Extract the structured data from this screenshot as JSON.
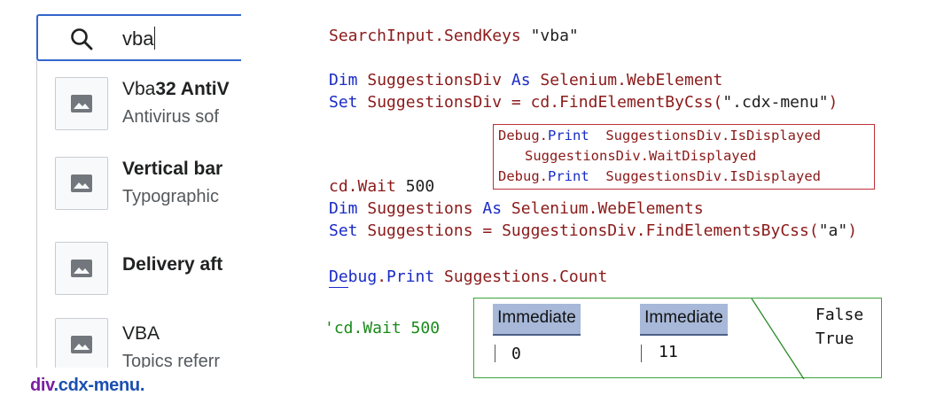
{
  "search": {
    "value": "vba"
  },
  "suggestions": [
    {
      "title_plain": "Vba",
      "title_bold": "32 AntiV",
      "description": "Antivirus sof"
    },
    {
      "title_plain": "",
      "title_bold": "Vertical bar",
      "description": "Typographic"
    },
    {
      "title_plain": "",
      "title_bold": "Delivery aft",
      "description": ""
    },
    {
      "title_plain": "VBA",
      "title_bold": "",
      "description": "Topics referr"
    }
  ],
  "footer_tag": {
    "element": "div",
    "class": ".cdx-menu."
  },
  "code": {
    "line1": {
      "obj": "SearchInput.SendKeys ",
      "str": "\"vba\""
    },
    "line2": {
      "kw1": "Dim",
      "mid": " SuggestionsDiv ",
      "kw2": "As",
      "type": " Selenium.WebElement"
    },
    "line3": {
      "kw": "Set",
      "mid": " SuggestionsDiv = cd.FindElementByCss(",
      "str": "\".cdx-menu\"",
      "end": ")"
    },
    "debug1": {
      "obj": "Debug",
      "dot": ".",
      "kw": "Print",
      "rest": "  SuggestionsDiv.IsDisplayed"
    },
    "debug2": {
      "text": "SuggestionsDiv.WaitDisplayed"
    },
    "debug3": {
      "obj": "Debug",
      "dot": ".",
      "kw": "Print",
      "rest": "  SuggestionsDiv.IsDisplayed"
    },
    "line4": {
      "obj": "cd.Wait ",
      "num": "500"
    },
    "line5": {
      "kw1": "Dim",
      "mid": " Suggestions ",
      "kw2": "As",
      "type": " Selenium.WebElements"
    },
    "line6": {
      "kw": "Set",
      "mid": " Suggestions = SuggestionsDiv.FindElementsByCss(",
      "str": "\"a\"",
      "end": ")"
    },
    "line7": {
      "obj": "Debug",
      "dot": ".",
      "kw": "Print",
      "rest": " Suggestions.Count"
    },
    "comment": "'cd.Wait 500"
  },
  "results": {
    "immediate1": {
      "header": "Immediate",
      "value": "0"
    },
    "immediate2": {
      "header": "Immediate",
      "value": "11"
    },
    "bool1": "False",
    "bool2": "True"
  }
}
